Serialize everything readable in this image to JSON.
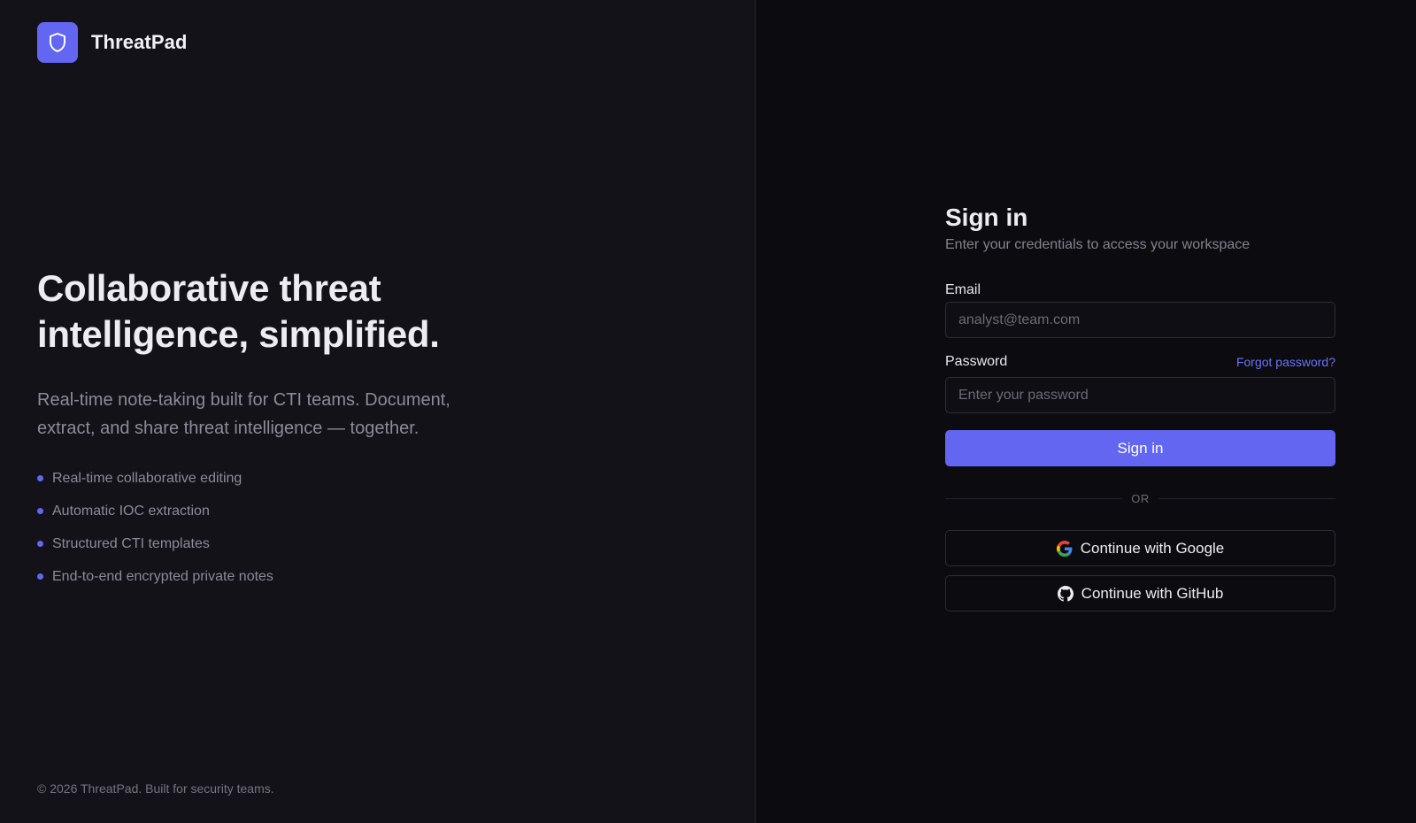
{
  "brand": {
    "name": "ThreatPad",
    "logo_icon": "shield-icon",
    "accent_color": "#6366f1"
  },
  "hero": {
    "headline_line1": "Collaborative threat",
    "headline_line2": "intelligence, simplified.",
    "sub_line1": "Real-time note-taking built for CTI teams. Document,",
    "sub_line2": "extract, and share threat intelligence — together.",
    "features": [
      "Real-time collaborative editing",
      "Automatic IOC extraction",
      "Structured CTI templates",
      "End-to-end encrypted private notes"
    ]
  },
  "footer": {
    "text": "© 2026 ThreatPad. Built for security teams."
  },
  "signin": {
    "title": "Sign in",
    "subtitle": "Enter your credentials to access your workspace",
    "email_label": "Email",
    "email_placeholder": "analyst@team.com",
    "email_value": "",
    "password_label": "Password",
    "forgot_link": "Forgot password?",
    "password_placeholder": "Enter your password",
    "password_value": "",
    "submit_label": "Sign in",
    "divider_text": "OR",
    "google_label": "Continue with Google",
    "google_icon": "google-icon",
    "github_label": "Continue with GitHub",
    "github_icon": "github-icon"
  }
}
